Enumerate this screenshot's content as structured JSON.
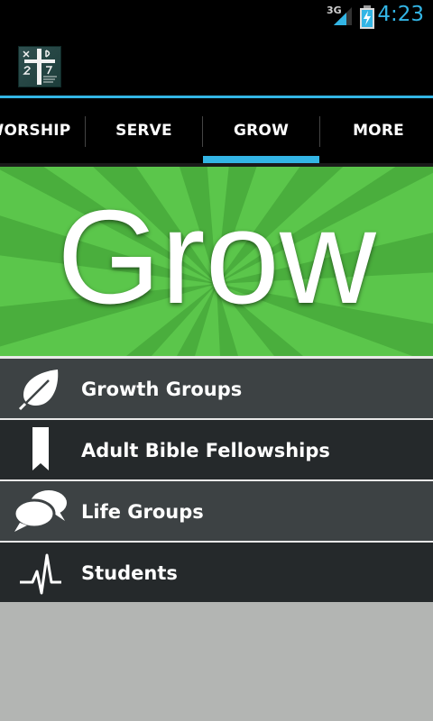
{
  "status_bar": {
    "network": "3G",
    "time": "4:23",
    "accent_color": "#33b5e5"
  },
  "action_bar": {
    "logo_icon": "church-cross-logo-icon"
  },
  "tabs": [
    {
      "label": "WORSHIP",
      "selected": false
    },
    {
      "label": "SERVE",
      "selected": false
    },
    {
      "label": "GROW",
      "selected": true
    },
    {
      "label": "MORE",
      "selected": false
    }
  ],
  "banner": {
    "title": "Grow",
    "color": "#5bc64b"
  },
  "menu": [
    {
      "label": "Growth Groups",
      "icon": "leaf-icon"
    },
    {
      "label": "Adult Bible Fellowships",
      "icon": "bookmark-icon"
    },
    {
      "label": "Life Groups",
      "icon": "chat-bubbles-icon"
    },
    {
      "label": "Students",
      "icon": "pulse-icon"
    }
  ]
}
